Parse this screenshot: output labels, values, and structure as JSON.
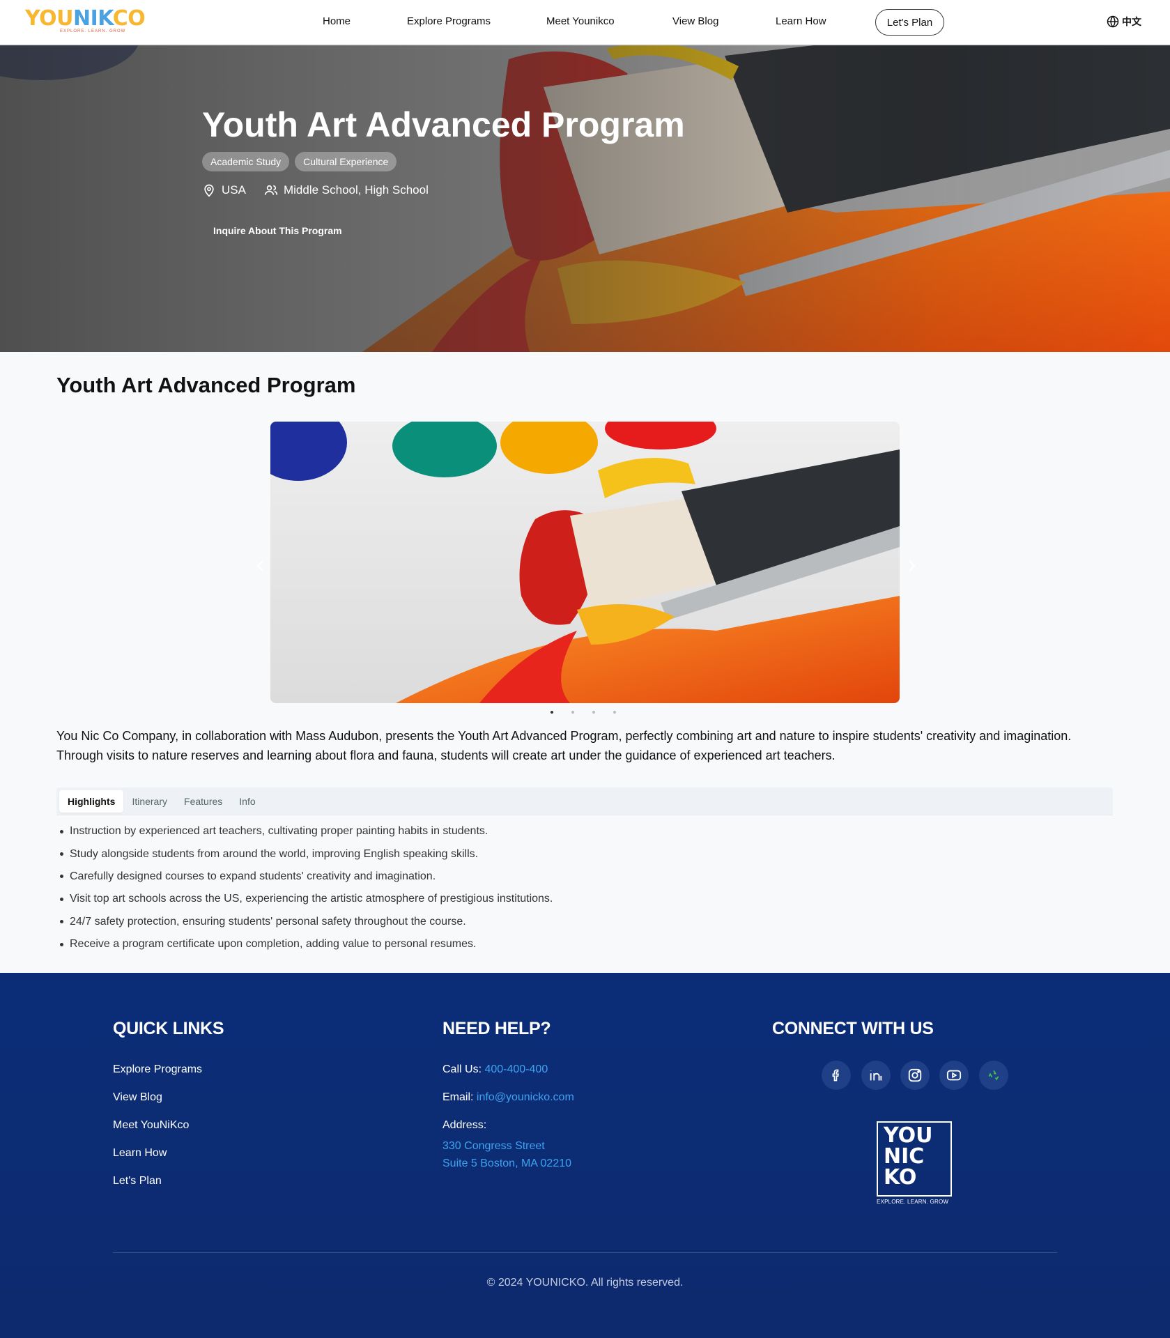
{
  "nav": {
    "logo_text_parts": [
      "YOU",
      "NIK",
      "CO"
    ],
    "logo_tagline": "EXPLORE. LEARN. GROW",
    "links": [
      "Home",
      "Explore Programs",
      "Meet Younikco",
      "View Blog",
      "Learn How"
    ],
    "cta": "Let's Plan",
    "language": "中文",
    "language_icon": "globe-icon"
  },
  "hero": {
    "title": "Youth Art Advanced Program",
    "tags": [
      "Academic Study",
      "Cultural Experience"
    ],
    "location": "USA",
    "location_icon": "map-pin-icon",
    "audience": "Middle School, High School",
    "audience_icon": "users-icon",
    "button": "Inquire About This Program"
  },
  "main": {
    "title": "Youth Art Advanced Program",
    "carousel": {
      "slide_count": 4,
      "active_index": 0,
      "prev_icon": "chevron-left-icon",
      "next_icon": "chevron-right-icon"
    },
    "description": "You Nic Co Company, in collaboration with Mass Audubon, presents the Youth Art Advanced Program, perfectly combining art and nature to inspire students' creativity and imagination. Through visits to nature reserves and learning about flora and fauna, students will create art under the guidance of experienced art teachers.",
    "tabs": [
      "Highlights",
      "Itinerary",
      "Features",
      "Info"
    ],
    "active_tab": "Highlights",
    "highlights": [
      "Instruction by experienced art teachers, cultivating proper painting habits in students.",
      "Study alongside students from around the world, improving English speaking skills.",
      "Carefully designed courses to expand students' creativity and imagination.",
      "Visit top art schools across the US, experiencing the artistic atmosphere of prestigious institutions.",
      "24/7 safety protection, ensuring students' personal safety throughout the course.",
      "Receive a program certificate upon completion, adding value to personal resumes."
    ]
  },
  "footer": {
    "quick_links_title": "QUICK LINKS",
    "quick_links": [
      "Explore Programs",
      "View Blog",
      "Meet YouNiKco",
      "Learn How",
      "Let's Plan"
    ],
    "help_title": "NEED HELP?",
    "call_label": "Call Us:",
    "phone": "400-400-400",
    "email_label": "Email:",
    "email": "info@younicko.com",
    "address_label": "Address:",
    "address_line1": "330 Congress Street",
    "address_line2": "Suite 5 Boston, MA 02210",
    "connect_title": "CONNECT WITH US",
    "social_icons": [
      "facebook-icon",
      "linkedin-icon",
      "instagram-icon",
      "youtube-icon",
      "wechat-icon"
    ],
    "logo_lines": [
      "YOU",
      "NIC",
      "KO"
    ],
    "logo_tagline": "EXPLORE. LEARN. GROW",
    "copyright": "© 2024 YOUNICKO. All rights reserved."
  },
  "colors": {
    "logo_yellow": "#f7b731",
    "logo_blue": "#4aa3e0",
    "footer_bg": "#0b2d78",
    "footer_accent": "#3fa3f0"
  }
}
